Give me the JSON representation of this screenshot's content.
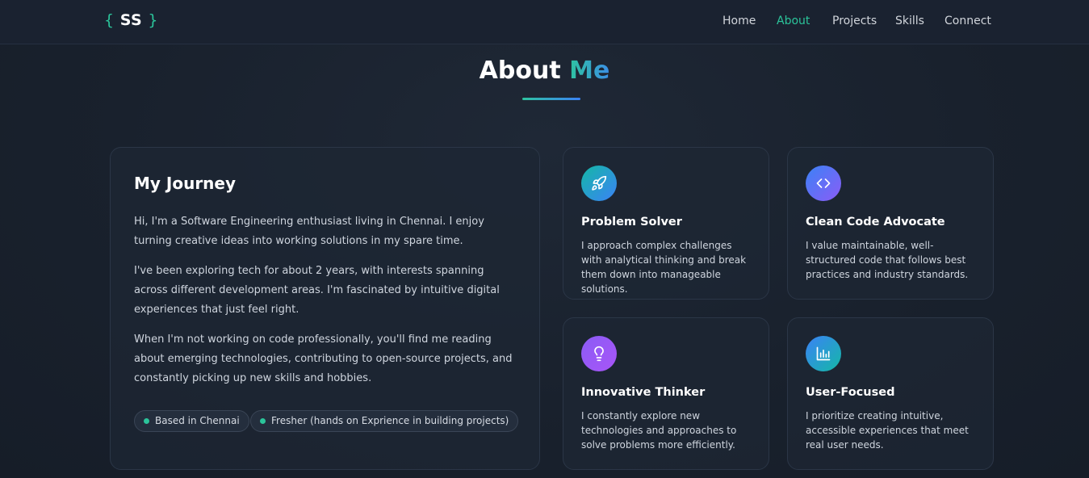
{
  "nav": {
    "logo_open": "{",
    "logo_text": "SS",
    "logo_close": "}",
    "links": [
      {
        "label": "Home",
        "active": false
      },
      {
        "label": "About",
        "active": true
      },
      {
        "label": "Projects",
        "active": false
      },
      {
        "label": "Skills",
        "active": false
      },
      {
        "label": "Connect",
        "active": false
      }
    ]
  },
  "section": {
    "title_main": "About",
    "title_accent": "Me"
  },
  "journey": {
    "heading": "My Journey",
    "paragraphs": [
      "Hi, I'm a Software Engineering enthusiast living in Chennai. I enjoy turning creative ideas into working solutions in my spare time.",
      "I've been exploring tech for about 2 years, with interests spanning across different development areas. I'm fascinated by intuitive digital experiences that just feel right.",
      "When I'm not working on code professionally, you'll find me reading about emerging technologies, contributing to open-source projects, and constantly picking up new skills and hobbies."
    ],
    "tags": [
      "Based in Chennai",
      "Fresher (hands on Exprience in building projects)"
    ]
  },
  "features": [
    {
      "icon": "rocket-icon",
      "title": "Problem Solver",
      "text": "I approach complex challenges with analytical thinking and break them down into manageable solutions."
    },
    {
      "icon": "code-icon",
      "title": "Clean Code Advocate",
      "text": "I value maintainable, well-structured code that follows best practices and industry standards."
    },
    {
      "icon": "lightbulb-icon",
      "title": "Innovative Thinker",
      "text": "I constantly explore new technologies and approaches to solve problems more efficiently."
    },
    {
      "icon": "bar-chart-icon",
      "title": "User-Focused",
      "text": "I prioritize creating intuitive, accessible experiences that meet real user needs."
    }
  ],
  "colors": {
    "accent_green": "#2bc49a",
    "accent_blue": "#3b82f6",
    "background": "#18202c"
  }
}
